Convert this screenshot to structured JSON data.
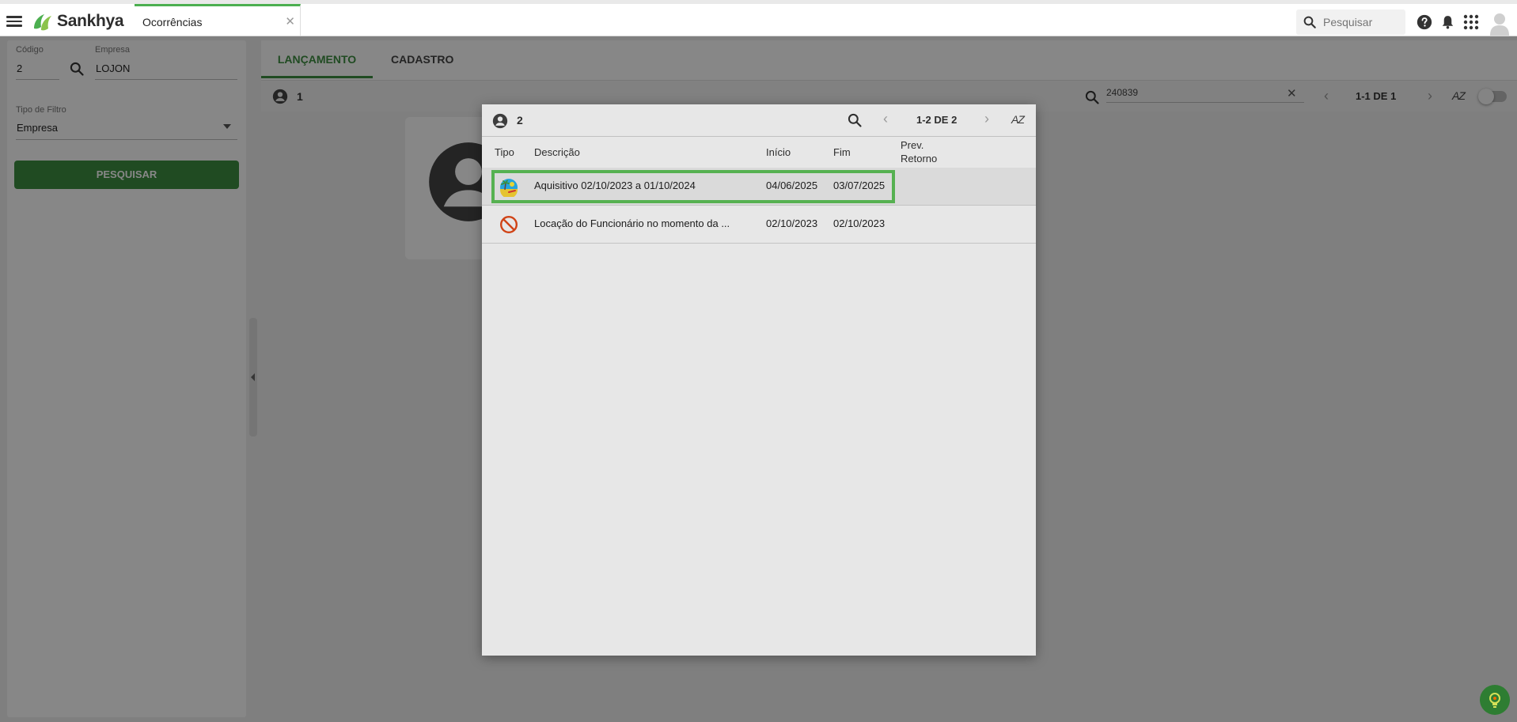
{
  "app": {
    "brand": "Sankhya",
    "tab_label": "Ocorrências",
    "search_placeholder": "Pesquisar"
  },
  "filters": {
    "codigo_label": "Código",
    "codigo_value": "2",
    "empresa_label": "Empresa",
    "empresa_value": "LOJON",
    "tipo_filtro_label": "Tipo de Filtro",
    "tipo_filtro_value": "Empresa",
    "search_button": "PESQUISAR"
  },
  "main": {
    "tabs": [
      "LANÇAMENTO",
      "CADASTRO"
    ],
    "record_count": "1",
    "search_value": "240839",
    "pagination": "1-1 DE 1",
    "sort_label": "AZ"
  },
  "modal": {
    "count": "2",
    "pagination": "1-2 DE 2",
    "sort_label": "AZ",
    "columns": {
      "tipo": "Tipo",
      "descricao": "Descrição",
      "inicio": "Início",
      "fim": "Fim",
      "prev_retorno_1": "Prev.",
      "prev_retorno_2": "Retorno"
    },
    "rows": [
      {
        "icon": "vacation-icon",
        "descricao": "Aquisitivo 02/10/2023 a 01/10/2024",
        "inicio": "04/06/2025",
        "fim": "03/07/2025",
        "selected": true
      },
      {
        "icon": "prohibited-icon",
        "descricao": "Locação do Funcionário no momento da ...",
        "inicio": "02/10/2023",
        "fim": "02/10/2023",
        "selected": false
      }
    ]
  },
  "colors": {
    "accent": "#3e8e41",
    "highlight": "#5fc45a",
    "overlay": "rgba(0,0,0,0.47)"
  }
}
